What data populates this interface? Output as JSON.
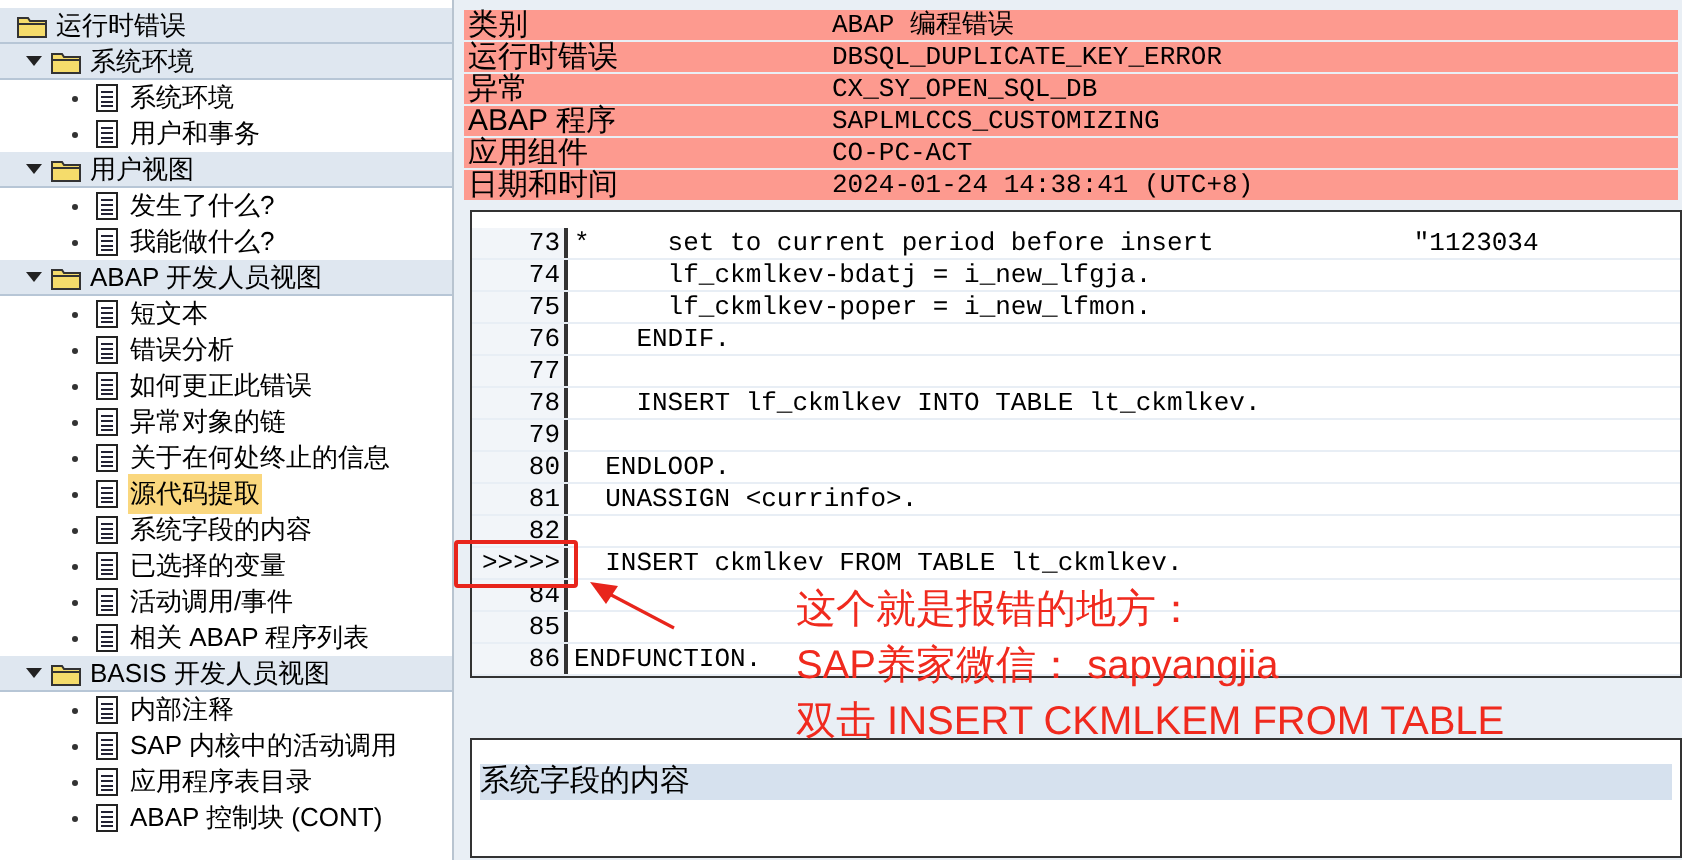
{
  "tree": {
    "label": "运行时错误",
    "children": [
      {
        "label": "系统环境",
        "expanded": true,
        "children": [
          {
            "label": "系统环境",
            "selected": false
          },
          {
            "label": "用户和事务",
            "selected": false
          }
        ]
      },
      {
        "label": "用户视图",
        "expanded": true,
        "children": [
          {
            "label": "发生了什么?",
            "selected": false
          },
          {
            "label": "我能做什么?",
            "selected": false
          }
        ]
      },
      {
        "label": "ABAP 开发人员视图",
        "expanded": true,
        "children": [
          {
            "label": "短文本",
            "selected": false
          },
          {
            "label": "错误分析",
            "selected": false
          },
          {
            "label": "如何更正此错误",
            "selected": false
          },
          {
            "label": "异常对象的链",
            "selected": false
          },
          {
            "label": "关于在何处终止的信息",
            "selected": false
          },
          {
            "label": "源代码提取",
            "selected": true
          },
          {
            "label": "系统字段的内容",
            "selected": false
          },
          {
            "label": "已选择的变量",
            "selected": false
          },
          {
            "label": "活动调用/事件",
            "selected": false
          },
          {
            "label": "相关 ABAP 程序列表",
            "selected": false
          }
        ]
      },
      {
        "label": "BASIS 开发人员视图",
        "expanded": true,
        "children": [
          {
            "label": "内部注释",
            "selected": false
          },
          {
            "label": "SAP 内核中的活动调用",
            "selected": false
          },
          {
            "label": "应用程序表目录",
            "selected": false
          },
          {
            "label": "ABAP 控制块 (CONT)",
            "selected": false
          }
        ]
      }
    ]
  },
  "header": [
    {
      "label": "类别",
      "value": "ABAP 编程错误"
    },
    {
      "label": "运行时错误",
      "value": "DBSQL_DUPLICATE_KEY_ERROR"
    },
    {
      "label": "异常",
      "value": "CX_SY_OPEN_SQL_DB"
    },
    {
      "label": "ABAP 程序",
      "value": "SAPLMLCCS_CUSTOMIZING"
    },
    {
      "label": "应用组件",
      "value": "CO-PC-ACT"
    },
    {
      "label": "日期和时间",
      "value": "2024-01-24 14:38:41 (UTC+8)"
    }
  ],
  "code_lines": [
    {
      "gutter": "73",
      "code": "*     set to current period before insert",
      "comment": "\"1123034",
      "marked": false
    },
    {
      "gutter": "74",
      "code": "      lf_ckmlkev-bdatj = i_new_lfgja.",
      "marked": false
    },
    {
      "gutter": "75",
      "code": "      lf_ckmlkev-poper = i_new_lfmon.",
      "marked": false
    },
    {
      "gutter": "76",
      "code": "    ENDIF.",
      "marked": false
    },
    {
      "gutter": "77",
      "marked": false
    },
    {
      "gutter": "78",
      "code": "    INSERT lf_ckmlkev INTO TABLE lt_ckmlkev.",
      "marked": false
    },
    {
      "gutter": "79",
      "marked": false
    },
    {
      "gutter": "80",
      "code": "  ENDLOOP.",
      "marked": false
    },
    {
      "gutter": "81",
      "code": "  UNASSIGN <currinfo>.",
      "marked": false
    },
    {
      "gutter": "82",
      "marked": false
    },
    {
      "gutter": ">>>>>",
      "code": "  INSERT ckmlkev FROM TABLE lt_ckmlkev.",
      "marked": true
    },
    {
      "gutter": "84",
      "marked": false
    },
    {
      "gutter": "85",
      "marked": false
    },
    {
      "gutter": "86",
      "code": "ENDFUNCTION.",
      "marked": false
    }
  ],
  "annotation": [
    "这个就是报错的地方：",
    "SAP养家微信： sapyangjia",
    "双击 INSERT CKMLKEM FROM TABLE"
  ],
  "system_fields": {
    "title": "系统字段的内容"
  }
}
